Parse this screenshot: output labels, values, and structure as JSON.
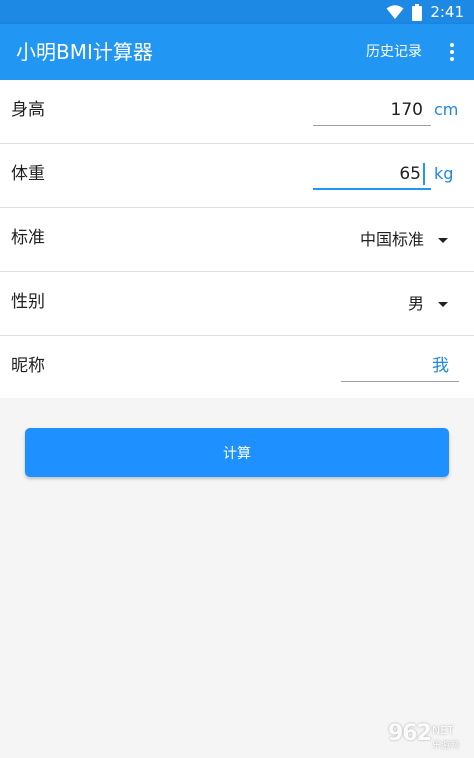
{
  "status_bar": {
    "time": "2:41",
    "icons": [
      "wifi-icon",
      "battery-icon"
    ]
  },
  "app_bar": {
    "title": "小明BMI计算器",
    "history_label": "历史记录",
    "menu_icon": "more-vert-icon"
  },
  "form": {
    "height": {
      "label": "身高",
      "value": "170",
      "unit": "cm"
    },
    "weight": {
      "label": "体重",
      "value": "65",
      "unit": "kg"
    },
    "standard": {
      "label": "标准",
      "selected": "中国标准"
    },
    "gender": {
      "label": "性别",
      "selected": "男"
    },
    "nickname": {
      "label": "昵称",
      "value": "我"
    }
  },
  "actions": {
    "calculate_label": "计算"
  },
  "watermark": {
    "number": "962",
    "suffix": "NET",
    "subtitle": "乐游网"
  },
  "colors": {
    "app_bar": "#2196f3",
    "status_bar": "#1e88e5",
    "accent": "#1e88e5",
    "button": "#1e90ff",
    "background": "#f5f5f5",
    "surface": "#ffffff"
  }
}
